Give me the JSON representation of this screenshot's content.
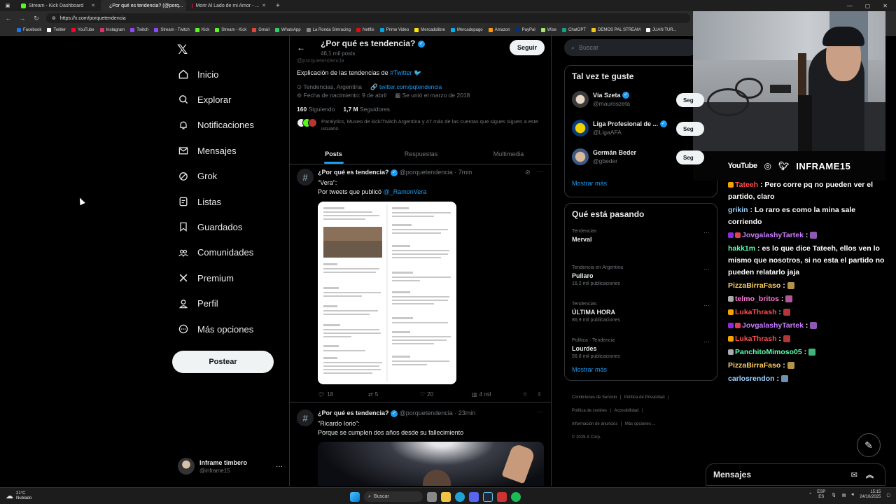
{
  "browser": {
    "tabs": [
      {
        "title": "Stream - Kick Dashboard",
        "color": "#53fc18"
      },
      {
        "title": "¿Por qué es tendencia? (@porq...",
        "color": "#ffffff"
      },
      {
        "title": "Morir Al Lado de mi Amor - ...",
        "color": "#ff0033"
      }
    ],
    "url": "https://x.com/porquetendencia",
    "bookmarks": [
      "Facebook",
      "Twitter",
      "YouTube",
      "Instagram",
      "Twitch",
      "Stream - Twitch",
      "Kick",
      "Stream - Kick",
      "Gmail",
      "WhatsApp",
      "La Ronda Simracing",
      "Netflix",
      "Prime Video",
      "Mercadolibre",
      "Mercadopago",
      "Amazon",
      "PayPal",
      "Wise",
      "ChatGPT",
      "DEMOS PAL STREAM",
      "JUAN TUR..."
    ]
  },
  "nav": {
    "items": [
      "Inicio",
      "Explorar",
      "Notificaciones",
      "Mensajes",
      "Grok",
      "Listas",
      "Guardados",
      "Comunidades",
      "Premium",
      "Perfil",
      "Más opciones"
    ],
    "post_label": "Postear",
    "account_name": "Inframe timbero",
    "account_handle": "@inframe15"
  },
  "profile": {
    "name": "¿Por qué es tendencia?",
    "post_count": "46,1 mil posts",
    "follow_label": "Seguir",
    "handle_partial": "@porquetendencia",
    "bio_prefix": "Explicación de las tendencias de",
    "bio_link": "#Twitter",
    "location": "Tendencias, Argentina",
    "website": "twitter.com/pqtendencia",
    "birth": "Fecha de nacimiento: 9 de abril",
    "joined": "Se unió el marzo de 2018",
    "following_count": "160",
    "following_label": "Siguiendo",
    "followers_count": "1,7 M",
    "followers_label": "Seguidores",
    "followed_by": "Paralytics, Museo de kick/Twitch Argentina y 47 más de las cuentas que sigues siguen a este usuario"
  },
  "tabs": [
    "Posts",
    "Respuestas",
    "Multimedia"
  ],
  "tweets": [
    {
      "name": "¿Por qué es tendencia?",
      "handle": "@porquetendencia",
      "time": "7min",
      "line1": "\"Vera\":",
      "line2_prefix": "Por tweets que publicó",
      "line2_mention": "@_RamonVera",
      "replies": "18",
      "retweets": "5",
      "likes": "20",
      "views": "4 mil"
    },
    {
      "name": "¿Por qué es tendencia?",
      "handle": "@porquetendencia",
      "time": "23min",
      "line1": "\"Ricardo Iorio\":",
      "line2": "Porque se cumplen dos años desde su fallecimiento"
    }
  ],
  "right": {
    "search_placeholder": "Buscar",
    "suggest_title": "Tal vez te guste",
    "suggestions": [
      {
        "name": "Vía Szeta",
        "handle": "@mauroszeta",
        "verified": true
      },
      {
        "name": "Liga Profesional de ...",
        "handle": "@LigaAFA",
        "verified": true
      },
      {
        "name": "Germán Beder",
        "handle": "@gbeder",
        "verified": false
      }
    ],
    "follow_label": "Seg",
    "show_more": "Mostrar más",
    "trending_title": "Qué está pasando",
    "trends": [
      {
        "category": "Tendencias",
        "name": "Merval",
        "count": ""
      },
      {
        "category": "Tendencia en Argentina",
        "name": "Pullaro",
        "count": "16,2 mil publicaciones"
      },
      {
        "category": "Tendencias",
        "name": "ÚLTIMA HORA",
        "count": "86,9 mil publicaciones"
      },
      {
        "category": "Política · Tendencia",
        "name": "Lourdes",
        "count": "56,8 mil publicaciones"
      }
    ],
    "footer": [
      "Condiciones de Servicio",
      "Política de Privacidad",
      "Política de cookies",
      "Accesibilidad",
      "Información de anuncios",
      "Más opciones ...",
      "© 2025 X Corp."
    ]
  },
  "stream": {
    "social_youtube": "YouTube",
    "channel_name": "INFRAME15",
    "chat": [
      {
        "user": "Tateeh",
        "color": "#ff4d4d",
        "msg": "Pero corre pq no pueden ver el partido, claro"
      },
      {
        "user": "grikin",
        "color": "#9ad0ff",
        "msg": "Lo raro es como la mina sale corriendo"
      },
      {
        "user": "JovgalashyTartek",
        "color": "#c77dff",
        "msg": ""
      },
      {
        "user": "hakk1m",
        "color": "#5cffb0",
        "msg": "es lo que dice Tateeh, ellos ven lo mismo que nosotros, si no esta el partido no pueden relatarlo jaja"
      },
      {
        "user": "PizzaBirraFaso",
        "color": "#ffd166",
        "msg": ""
      },
      {
        "user": "telmo_britos",
        "color": "#ff7bd5",
        "msg": ""
      },
      {
        "user": "LukaThrash",
        "color": "#ff4d4d",
        "msg": ""
      },
      {
        "user": "JovgalashyTartek",
        "color": "#c77dff",
        "msg": ""
      },
      {
        "user": "LukaThrash",
        "color": "#ff4d4d",
        "msg": ""
      },
      {
        "user": "PanchitoMimoso05",
        "color": "#5cffb0",
        "msg": ""
      },
      {
        "user": "PizzaBirraFaso",
        "color": "#ffd166",
        "msg": ""
      },
      {
        "user": "carlosrendon",
        "color": "#9ad0ff",
        "msg": ""
      }
    ],
    "messages_label": "Mensajes"
  },
  "taskbar": {
    "weather_temp": "21°C",
    "weather_desc": "Nublado",
    "search_label": "Buscar",
    "lang1": "ESP",
    "lang2": "ES",
    "time": "15:15",
    "date": "24/10/2025"
  }
}
